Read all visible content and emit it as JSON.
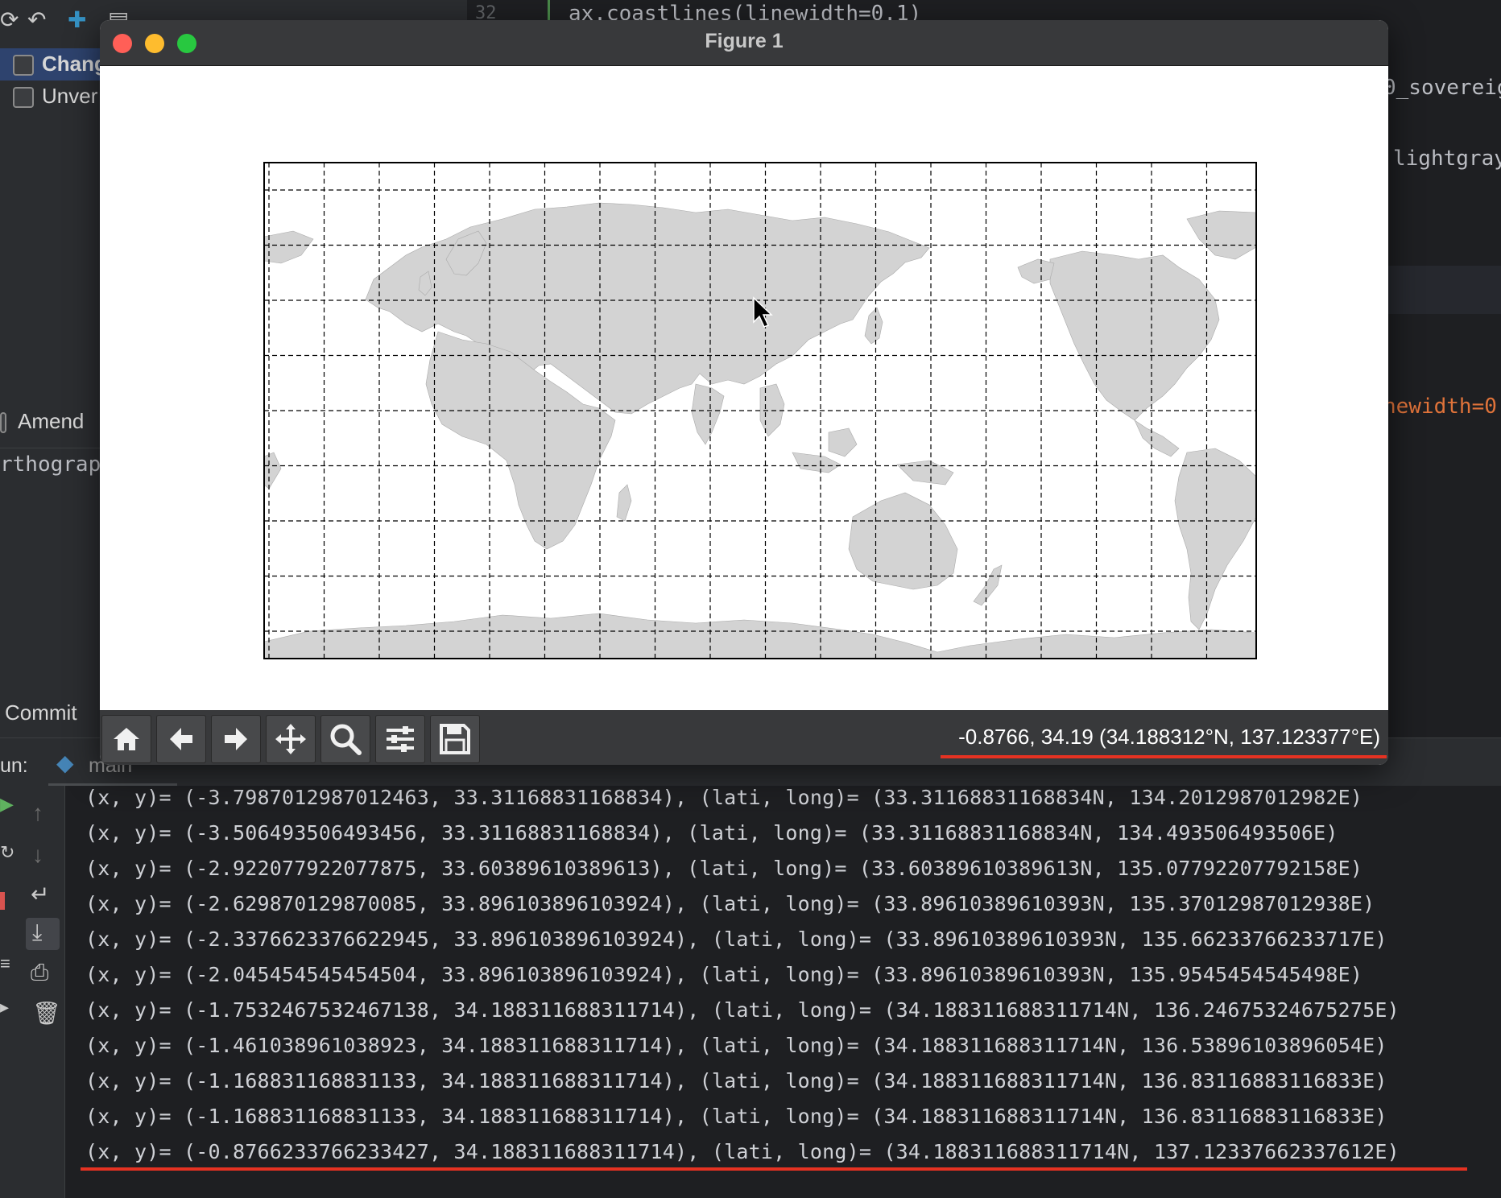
{
  "ide": {
    "code_lines": [
      {
        "text": "ax.coastlines(linewidth=0.1)"
      },
      {
        "text": "0_sovereig"
      },
      {
        "text": "lightgray"
      },
      {
        "text": "newidth=0"
      }
    ],
    "gutter_line": "32",
    "commit_panel": {
      "changes_label": "Chang",
      "unversioned_label": "Unver",
      "amend_label": "Amend",
      "message_text": "rthograp",
      "commit_button": "Commit"
    },
    "run": {
      "label": "un:",
      "tab": "main"
    }
  },
  "figure": {
    "title": "Figure 1",
    "coord_readout": "-0.8766, 34.19 (34.188312°N, 137.123377°E)",
    "toolbar_icons": [
      "home-icon",
      "back-arrow-icon",
      "forward-arrow-icon",
      "pan-icon",
      "zoom-icon",
      "configure-subplots-icon",
      "save-icon"
    ],
    "map": {
      "land_color": "#d3d3d3",
      "grid_style": "dashed",
      "grid_vertical_lines": 18,
      "grid_horizontal_lines": 9
    }
  },
  "console": {
    "lines": [
      "(x, y)= (-3.7987012987012463, 33.31168831168834), (lati, long)= (33.31168831168834N, 134.2012987012982E)",
      "(x, y)= (-3.506493506493456, 33.31168831168834), (lati, long)= (33.31168831168834N, 134.493506493506E)",
      "(x, y)= (-2.922077922077875, 33.60389610389613), (lati, long)= (33.60389610389613N, 135.07792207792158E)",
      "(x, y)= (-2.629870129870085, 33.896103896103924), (lati, long)= (33.89610389610393N, 135.37012987012938E)",
      "(x, y)= (-2.3376623376622945, 33.896103896103924), (lati, long)= (33.89610389610393N, 135.66233766233717E)",
      "(x, y)= (-2.045454545454504, 33.896103896103924), (lati, long)= (33.89610389610393N, 135.9545454545498E)",
      "(x, y)= (-1.7532467532467138, 34.188311688311714), (lati, long)= (34.188311688311714N, 136.24675324675275E)",
      "(x, y)= (-1.461038961038923, 34.188311688311714), (lati, long)= (34.188311688311714N, 136.53896103896054E)",
      "(x, y)= (-1.168831168831133, 34.188311688311714), (lati, long)= (34.188311688311714N, 136.83116883116833E)",
      "(x, y)= (-1.168831168831133, 34.188311688311714), (lati, long)= (34.188311688311714N, 136.83116883116833E)",
      "(x, y)= (-0.8766233766233427, 34.188311688311714), (lati, long)= (34.188311688311714N, 137.12337662337612E)"
    ]
  }
}
